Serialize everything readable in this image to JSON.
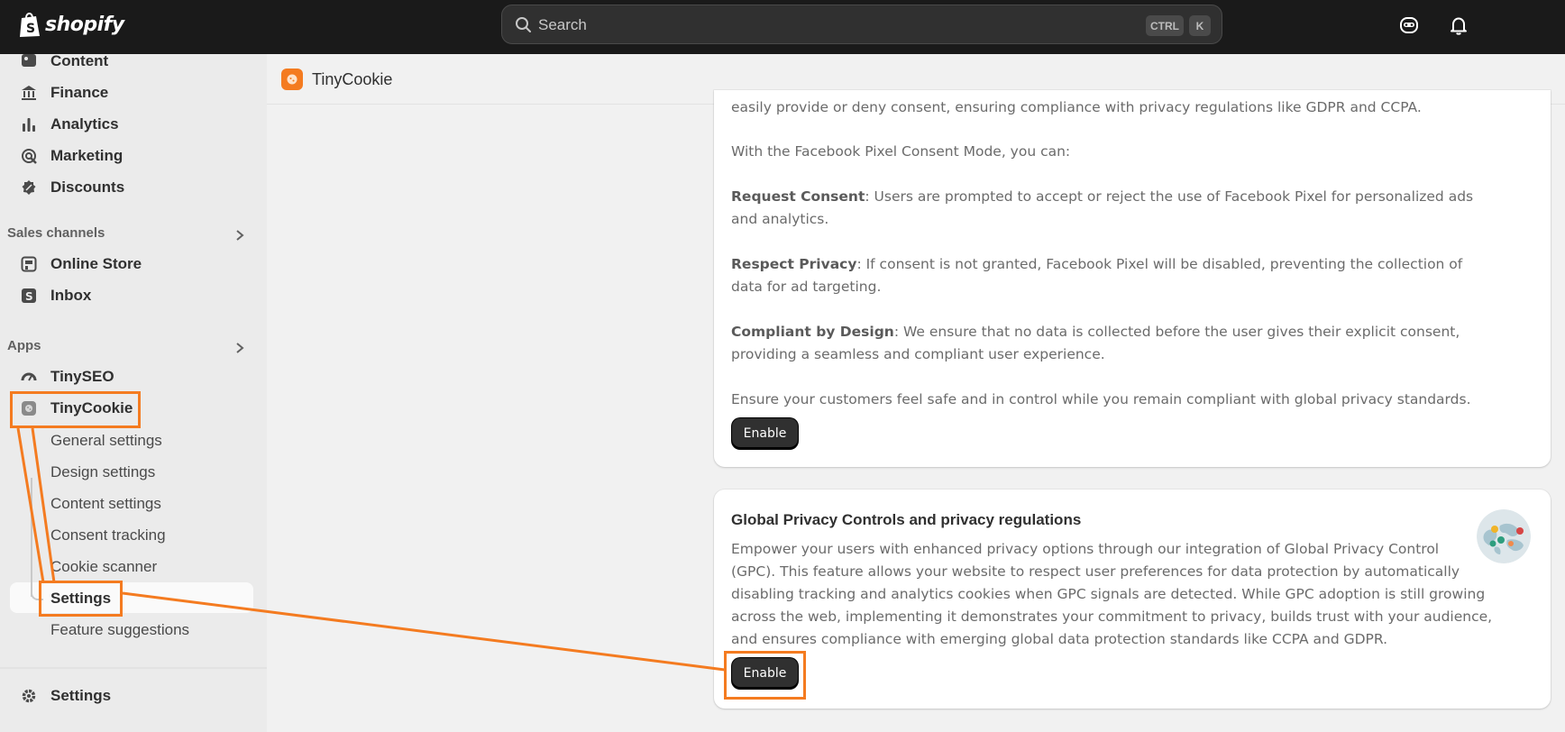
{
  "topbar": {
    "brand": "shopify",
    "search_placeholder": "Search",
    "shortcut_ctrl": "CTRL",
    "shortcut_k": "K"
  },
  "sidebar": {
    "items_top": [
      {
        "label": "Content",
        "icon": "content-icon"
      },
      {
        "label": "Finance",
        "icon": "bank-icon"
      },
      {
        "label": "Analytics",
        "icon": "bar-chart-icon"
      },
      {
        "label": "Marketing",
        "icon": "target-icon"
      },
      {
        "label": "Discounts",
        "icon": "discount-icon"
      }
    ],
    "sales_channels_heading": "Sales channels",
    "sales_channels": [
      {
        "label": "Online Store",
        "icon": "store-icon"
      },
      {
        "label": "Inbox",
        "icon": "inbox-icon"
      }
    ],
    "apps_heading": "Apps",
    "apps": [
      {
        "label": "TinySEO",
        "icon": "gauge-icon"
      },
      {
        "label": "TinyCookie",
        "icon": "cookie-icon"
      }
    ],
    "tinycookie_subitems": [
      "General settings",
      "Design settings",
      "Content settings",
      "Consent tracking",
      "Cookie scanner",
      "Settings",
      "Feature suggestions"
    ],
    "active_subitem": "Settings",
    "footer_settings": "Settings"
  },
  "app_header": {
    "title": "TinyCookie"
  },
  "card_facebook": {
    "intro_partial": "easily provide or deny consent, ensuring compliance with privacy regulations like GDPR and CCPA.",
    "lead": "With the Facebook Pixel Consent Mode, you can:",
    "points": [
      {
        "title": "Request Consent",
        "text": ": Users are prompted to accept or reject the use of Facebook Pixel for personalized ads",
        "cont": "and analytics."
      },
      {
        "title": "Respect Privacy",
        "text": ": If consent is not granted, Facebook Pixel will be disabled, preventing the collection of",
        "cont": "data for ad targeting."
      },
      {
        "title": "Compliant by Design",
        "text": ": We ensure that no data is collected before the user gives their explicit consent,",
        "cont": "providing a seamless and compliant user experience."
      }
    ],
    "closing": "Ensure your customers feel safe and in control while you remain compliant with global privacy standards.",
    "button": "Enable"
  },
  "card_gpc": {
    "title": "Global Privacy Controls and privacy regulations",
    "lines": [
      "Empower your users with enhanced privacy options through our integration of Global Privacy Control",
      "(GPC). This feature allows your website to respect user preferences for data protection by automatically",
      "disabling tracking and analytics cookies when GPC signals are detected. While GPC adoption is still growing",
      "across the web, implementing it demonstrates your commitment to privacy, builds trust with your audience,",
      "and ensures compliance with emerging global data protection standards like CCPA and GDPR."
    ],
    "button": "Enable",
    "image_icon": "world-map-globe-icon"
  },
  "colors": {
    "annotation": "#f47b20",
    "topbar": "#1a1a1a",
    "button": "#303030"
  }
}
